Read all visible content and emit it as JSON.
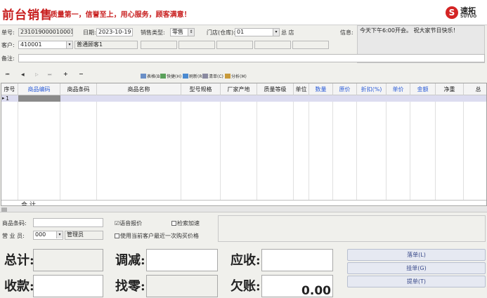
{
  "header": {
    "brand": "前台销售",
    "slogan": "- 质量第一，信誉至上，用心服务，顾客满意！",
    "logo_zh": "速拓",
    "logo_en": "SUTUO",
    "logo_mark": "S"
  },
  "form": {
    "order_no_label": "单号:",
    "order_no": "231019000010001",
    "date_label": "日期:",
    "date": "2023-10-19",
    "sales_type_label": "销售类型:",
    "sales_type": "零售",
    "store_label": "门店(仓库):",
    "store_code": "01",
    "store_name": "总 店",
    "customer_label": "客户:",
    "customer_code": "410001",
    "customer_name": "普通顾客1",
    "remark_label": "备注:",
    "info_label": "信息:",
    "info_text": "今天下午6:00开会。 祝大家节日快乐！"
  },
  "toolbar": {
    "nav_first": "⏮",
    "nav_prev": "◀",
    "nav_next": "▷",
    "nav_last": "⏭",
    "add": "+",
    "remove": "−",
    "items": [
      "表格(B)",
      "快捷(H)",
      "刷新(R)",
      "清单(C)",
      "分析(M)"
    ]
  },
  "grid": {
    "columns": [
      "序号",
      "商品编码",
      "商品条码",
      "商品名称",
      "型号规格",
      "厂家产地",
      "质量等级",
      "单位",
      "数量",
      "原价",
      "折扣(%)",
      "单价",
      "金额",
      "净重",
      "总"
    ],
    "blue_columns": [
      "商品编码",
      "数量",
      "原价",
      "折扣(%)",
      "单价",
      "金额"
    ],
    "rows": [
      {
        "no": "1"
      }
    ],
    "total_label": "合 计"
  },
  "options": {
    "barcode_label": "商品条码:",
    "voice_label": "语音报价",
    "voice_checked": "☑",
    "search_speed_label": "检索加速",
    "salesman_label": "营 业 员:",
    "salesman_code": "000",
    "salesman_name": "管理员",
    "last_price_label": "使用当前客户最近一次购买价格"
  },
  "totals": {
    "total_label": "总计:",
    "adjust_label": "调减:",
    "receivable_label": "应收:",
    "received_label": "收款:",
    "change_label": "找零:",
    "owed_label": "欠账:",
    "owed_value": "0.00"
  },
  "actions": {
    "hold": "落单(L)",
    "suspend": "挂单(G)",
    "retrieve": "提单(T)"
  }
}
